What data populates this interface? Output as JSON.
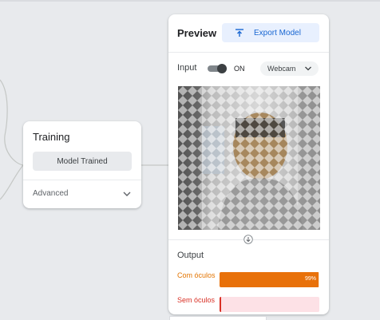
{
  "training": {
    "title": "Training",
    "status_button": "Model Trained",
    "advanced_label": "Advanced"
  },
  "preview": {
    "title": "Preview",
    "export_label": "Export Model",
    "input_label": "Input",
    "toggle_state": "ON",
    "input_source": "Webcam",
    "output_label": "Output",
    "classes": [
      {
        "label": "Com óculos",
        "confidence": 0.99,
        "percent_text": "99%",
        "color": "#e8710a"
      },
      {
        "label": "Sem óculos",
        "confidence": 0.01,
        "percent_text": "",
        "color": "#d93025"
      }
    ]
  },
  "colors": {
    "background": "#e8eaed",
    "accent_blue": "#1967d2",
    "class_orange": "#e8710a",
    "class_red": "#d93025"
  },
  "icons": {
    "export": "upload-icon",
    "advanced": "chevron-down-icon",
    "webcam": "chevron-down-icon",
    "flow": "arrow-down-icon"
  }
}
